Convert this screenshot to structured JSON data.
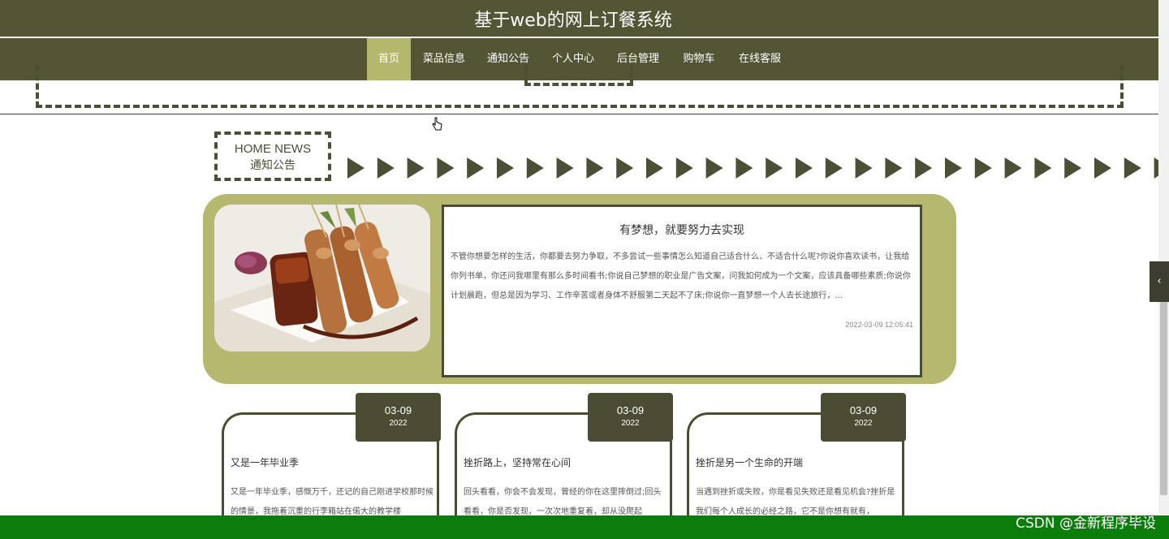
{
  "header": {
    "title": "基于web的网上订餐系统"
  },
  "nav": {
    "items": [
      {
        "label": "首页",
        "active": true
      },
      {
        "label": "菜品信息"
      },
      {
        "label": "通知公告"
      },
      {
        "label": "个人中心"
      },
      {
        "label": "后台管理"
      },
      {
        "label": "购物车"
      },
      {
        "label": "在线客服"
      }
    ]
  },
  "section": {
    "label_en": "HOME NEWS",
    "label_cn": "通知公告"
  },
  "feature": {
    "title": "有梦想，就要努力去实现",
    "desc": "不管你想要怎样的生活，你都要去努力争取，不多尝试一些事情怎么知道自己适合什么、不适合什么呢?你说你喜欢读书，让我给你列书单，你还问我哪里有那么多时间看书;你说自己梦想的职业是广告文案，问我如何成为一个文案，应该具备哪些素质;你说你计划晨跑，但总是因为学习、工作辛苦或者身体不舒服第二天起不了床;你说你一直梦想一个人去长途旅行，...",
    "time": "2022-03-09 12:05:41",
    "image_icon": "food-skewers-image"
  },
  "cards": [
    {
      "date": "03-09",
      "year": "2022",
      "title": "又是一年毕业季",
      "desc": "又是一年毕业季，感慨万千，还记的自己刚进学校那时候的情景，我拖着沉重的行李箱站在偌大的教学楼"
    },
    {
      "date": "03-09",
      "year": "2022",
      "title": "挫折路上，坚持常在心间",
      "desc": "回头看看，你会不会发现，曾经的你在这里摔倒过;回头看看，你是否发现，一次次地重复着，却从没爬起"
    },
    {
      "date": "03-09",
      "year": "2022",
      "title": "挫折是另一个生命的开端",
      "desc": "当遇到挫折或失败，你是看见失败还是看见机会?挫折是我们每个人成长的必经之路，它不是你想有就有，"
    }
  ],
  "side_toggle": {
    "icon": "chevron-left-icon",
    "glyph": "‹"
  },
  "watermark": "CSDN @金新程序毕设",
  "colors": {
    "primary": "#545535",
    "accent": "#b4b86c",
    "bottom": "#0b7d0b"
  }
}
